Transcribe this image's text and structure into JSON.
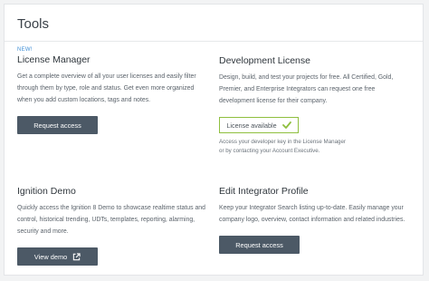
{
  "page": {
    "title": "Tools"
  },
  "cards": {
    "license_manager": {
      "badge": "NEW!",
      "title": "License Manager",
      "desc": "Get a complete overview of all your user licenses and easily filter through them by type, role and status. Get even more organized when you add custom locations, tags and notes.",
      "button": "Request access"
    },
    "dev_license": {
      "title": "Development License",
      "desc": "Design, build, and test your projects for free. All Certified, Gold, Premier, and Enterprise Integrators can request one free development license for their company.",
      "status": "License available",
      "note_line1": "Access your developer key in the License Manager",
      "note_line2": "or by contacting your Account Executive."
    },
    "ignition_demo": {
      "title": "Ignition Demo",
      "desc": "Quickly access the Ignition 8 Demo to showcase realtime status and control, historical trending, UDTs, templates, reporting, alarming, security and more.",
      "button": "View demo"
    },
    "integrator_profile": {
      "title": "Edit Integrator Profile",
      "desc": "Keep your Integrator Search listing up-to-date. Easily manage your company logo, overview, contact information and related industries.",
      "button": "Request access"
    }
  },
  "colors": {
    "button_bg": "#4c5966",
    "success": "#8fbf3f",
    "badge": "#3f8fd6"
  },
  "icons": {
    "status": "check-icon",
    "external": "external-link-icon"
  }
}
